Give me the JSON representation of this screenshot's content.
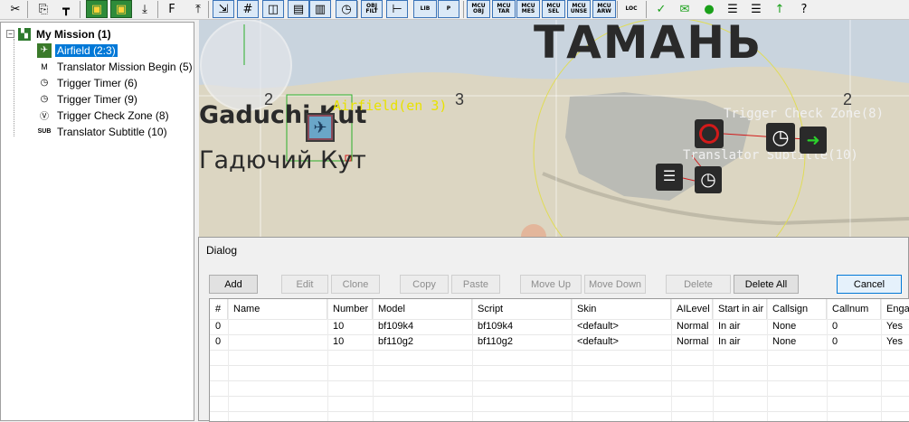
{
  "toolbar": {
    "buttons": [
      {
        "icon": "scissors-icon",
        "glyph": "✂"
      },
      {
        "icon": "copy-icon",
        "glyph": "⎘"
      },
      {
        "icon": "ruler-icon",
        "glyph": "┳"
      },
      {
        "icon": "map-layer-icon",
        "glyph": "▣"
      },
      {
        "icon": "map-layer-2-icon",
        "glyph": "▣"
      },
      {
        "icon": "import-icon",
        "glyph": "⤓"
      },
      {
        "icon": "font-icon",
        "glyph": "F"
      },
      {
        "icon": "export-icon",
        "glyph": "⤒"
      },
      {
        "icon": "arrows-icon",
        "glyph": "⇲"
      },
      {
        "icon": "grid-icon",
        "glyph": "#"
      },
      {
        "icon": "column-icon",
        "glyph": "◫"
      },
      {
        "icon": "text-box-icon",
        "glyph": "▤"
      },
      {
        "icon": "group-icon",
        "glyph": "▥"
      },
      {
        "icon": "clock-icon",
        "glyph": "◷"
      },
      {
        "icon": "filter-icon",
        "label": "OBJ FILT"
      },
      {
        "icon": "tree-icon",
        "glyph": "⊢"
      },
      {
        "icon": "library-icon",
        "label": "LIB"
      },
      {
        "icon": "properties-icon",
        "label": "P"
      },
      {
        "icon": "mcu-obj-icon",
        "label": "MCU OBJ"
      },
      {
        "icon": "mcu-tar-icon",
        "label": "MCU TAR"
      },
      {
        "icon": "mcu-mes-icon",
        "label": "MCU MES"
      },
      {
        "icon": "mcu-sel-icon",
        "label": "MCU SEL"
      },
      {
        "icon": "mcu-unse-icon",
        "label": "MCU UNSE"
      },
      {
        "icon": "mcu-arw-icon",
        "label": "MCU ARW"
      },
      {
        "icon": "loc-icon",
        "label": "LOC"
      },
      {
        "icon": "checkmark-icon",
        "glyph": "✓"
      },
      {
        "icon": "envelope-icon",
        "glyph": "✉"
      },
      {
        "icon": "dot-icon",
        "glyph": "●"
      },
      {
        "icon": "align-icon",
        "glyph": "☰"
      },
      {
        "icon": "align-2-icon",
        "glyph": "☰"
      },
      {
        "icon": "arrow-up-icon",
        "glyph": "↑"
      },
      {
        "icon": "help-icon",
        "glyph": "?"
      }
    ]
  },
  "tree": {
    "root": "My Mission (1)",
    "items": [
      {
        "label": "Airfield (2:3)",
        "icon": "airfield-icon",
        "selected": true
      },
      {
        "label": "Translator Mission Begin (5)",
        "icon": "translator-icon",
        "selected": false
      },
      {
        "label": "Trigger Timer (6)",
        "icon": "timer-icon",
        "selected": false
      },
      {
        "label": "Trigger Timer (9)",
        "icon": "timer-icon",
        "selected": false
      },
      {
        "label": "Trigger Check Zone (8)",
        "icon": "check-zone-icon",
        "selected": false
      },
      {
        "label": "Translator Subtitle (10)",
        "icon": "subtitle-icon",
        "selected": false
      }
    ]
  },
  "map": {
    "town_title": "ТАМАНЬ",
    "place_latin": "Gaduchi Kut",
    "place_cyrillic": "Гадючий Кут",
    "airfield_label": "Airfield(en 3)",
    "grid_numbers": [
      "2",
      "3",
      "2"
    ],
    "trigger_label_1": "Trigger Check Zone(8)",
    "trigger_label_2": "Translator Subtitle(10)"
  },
  "dialog": {
    "title": "Dialog",
    "buttons": {
      "add": "Add",
      "edit": "Edit",
      "clone": "Clone",
      "copy": "Copy",
      "paste": "Paste",
      "move_up": "Move Up",
      "move_down": "Move Down",
      "delete": "Delete",
      "delete_all": "Delete All",
      "cancel": "Cancel"
    },
    "columns": [
      "#",
      "Name",
      "Number",
      "Model",
      "Script",
      "Skin",
      "AILevel",
      "Start in air",
      "Callsign",
      "Callnum",
      "Enga"
    ],
    "rows": [
      [
        "0",
        "",
        "10",
        "bf109k4",
        "bf109k4",
        "<default>",
        "Normal",
        "In air",
        "None",
        "0",
        "Yes"
      ],
      [
        "0",
        "",
        "10",
        "bf110g2",
        "bf110g2",
        "<default>",
        "Normal",
        "In air",
        "None",
        "0",
        "Yes"
      ]
    ]
  },
  "colors": {
    "selection": "#0078d7",
    "map_bg": "#dcd6c2",
    "sea": "#c9d4de",
    "label_yellow": "#e8e200",
    "trigger_red": "#d21a1a"
  }
}
